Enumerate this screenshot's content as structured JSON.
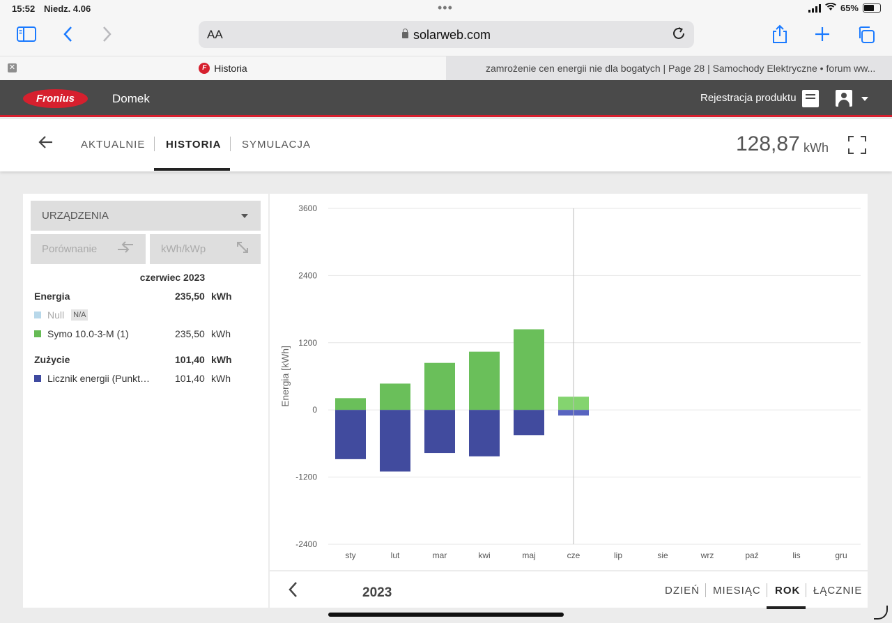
{
  "status": {
    "time": "15:52",
    "date": "Niedz. 4.06",
    "battery": "65%",
    "battery_level": 0.65
  },
  "browser": {
    "text_size": "AA",
    "url": "solarweb.com",
    "tabs": [
      {
        "title": "Historia",
        "active": true
      },
      {
        "title": "zamrożenie cen energii nie dla bogatych | Page 28 | Samochody Elektryczne • forum ww...",
        "active": false
      }
    ]
  },
  "app": {
    "brand": "Fronius",
    "site_name": "Domek",
    "register_label": "Rejestracja produktu"
  },
  "nav": {
    "tabs": [
      "AKTUALNIE",
      "HISTORIA",
      "SYMULACJA"
    ],
    "active": "HISTORIA",
    "total_value": "128,87",
    "total_unit": "kWh"
  },
  "panel": {
    "devices_label": "URZĄDZENIA",
    "compare_label": "Porównanie",
    "kwh_kwp_label": "kWh/kWp",
    "period": "czerwiec 2023",
    "energy": {
      "label": "Energia",
      "value": "235,50",
      "unit": "kWh",
      "items": [
        {
          "name": "Null",
          "value": "N/A",
          "color": "#b8d8ea"
        },
        {
          "name": "Symo 10.0-3-M (1)",
          "value": "235,50",
          "unit": "kWh",
          "color": "#66bb55"
        }
      ]
    },
    "consumption": {
      "label": "Zużycie",
      "value": "101,40",
      "unit": "kWh",
      "items": [
        {
          "name": "Licznik energii (Punkt…",
          "value": "101,40",
          "unit": "kWh",
          "color": "#3f4aa0"
        }
      ]
    }
  },
  "chart_data": {
    "type": "bar",
    "ylabel": "Energia [kWh]",
    "ylim": [
      -2400,
      3600
    ],
    "yticks": [
      3600,
      2400,
      1200,
      0,
      -1200,
      -2400
    ],
    "categories": [
      "sty",
      "lut",
      "mar",
      "kwi",
      "maj",
      "cze",
      "lip",
      "sie",
      "wrz",
      "paź",
      "lis",
      "gru"
    ],
    "series": [
      {
        "values": [
          210,
          470,
          840,
          1040,
          1440,
          235.5,
          null,
          null,
          null,
          null,
          null,
          null
        ],
        "color": "#6abf5a",
        "highlight_color": "#84d46f"
      },
      {
        "values": [
          -880,
          -1100,
          -770,
          -830,
          -450,
          -101.4,
          null,
          null,
          null,
          null,
          null,
          null
        ],
        "color": "#414b9e",
        "highlight_color": "#5864c0"
      }
    ],
    "selected_index": 5,
    "grid": true
  },
  "footer": {
    "year": "2023",
    "ranges": [
      "DZIEŃ",
      "MIESIĄC",
      "ROK",
      "ŁĄCZNIE"
    ],
    "active_range": "ROK"
  }
}
